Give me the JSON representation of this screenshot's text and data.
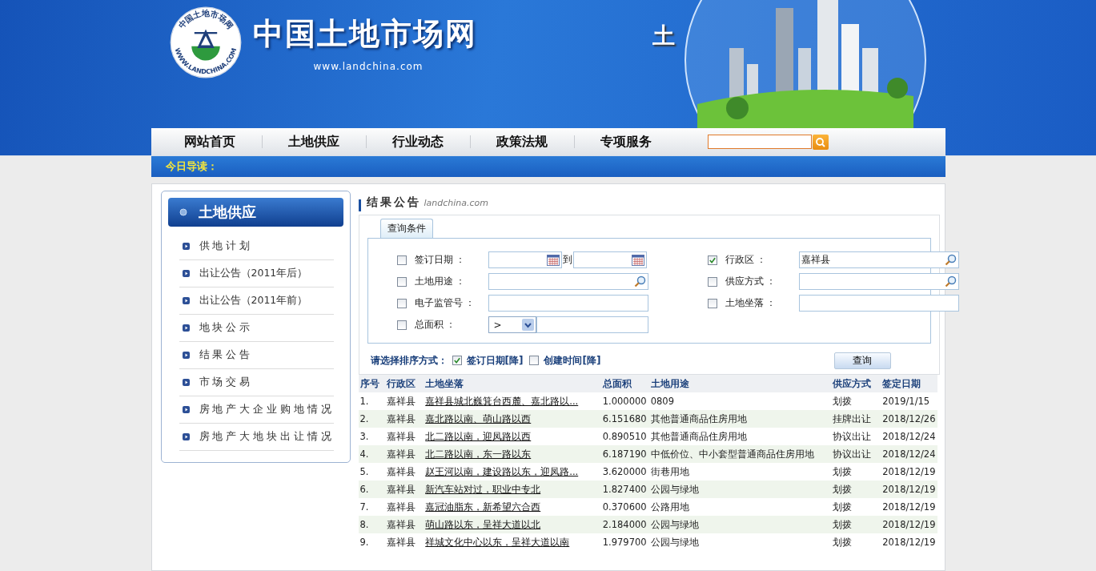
{
  "site": {
    "title": "中国土地市场网",
    "url": "www.landchina.com",
    "logo_ring_top": "中国土地市场网",
    "logo_ring_bottom": "WWW.LANDCHINA.COM",
    "banner_glyph": "土"
  },
  "nav": [
    {
      "label": "网站首页",
      "selected": false
    },
    {
      "label": "土地供应",
      "selected": false
    },
    {
      "label": "行业动态",
      "selected": false
    },
    {
      "label": "政策法规",
      "selected": false
    },
    {
      "label": "专项服务",
      "selected": false
    }
  ],
  "ticker": {
    "label": "今日导读："
  },
  "sidebar": {
    "title": "土地供应",
    "items": [
      {
        "label": "供 地 计 划",
        "selected": false
      },
      {
        "label": "出让公告（2011年后）",
        "selected": false
      },
      {
        "label": "出让公告（2011年前）",
        "selected": false
      },
      {
        "label": "地 块 公 示",
        "selected": false
      },
      {
        "label": "结 果 公 告",
        "selected": false
      },
      {
        "label": "市 场 交 易",
        "selected": false
      },
      {
        "label": "房 地 产 大 企 业 购 地 情 况",
        "selected": false
      },
      {
        "label": "房 地 产 大 地 块 出 让 情 况",
        "selected": false
      }
    ]
  },
  "section": {
    "title": "结果公告",
    "subtitle": "landchina.com"
  },
  "query": {
    "tab": "查询条件",
    "filters": [
      {
        "kind": "date_range",
        "label": "签订日期 ：",
        "checked": false,
        "separator": "到"
      },
      {
        "kind": "lookup",
        "label": "行政区 ：",
        "checked": true,
        "value": "嘉祥县"
      },
      {
        "kind": "lookup",
        "label": "土地用途 ：",
        "checked": false
      },
      {
        "kind": "lookup",
        "label": "供应方式 ：",
        "checked": false
      },
      {
        "kind": "text",
        "label": "电子监管号 ：",
        "checked": false
      },
      {
        "kind": "text",
        "label": "土地坐落 ：",
        "checked": false
      },
      {
        "kind": "compare",
        "label": "总面积 ：",
        "checked": false,
        "operator": ">"
      }
    ],
    "sort_label": "请选择排序方式：",
    "sort_options": [
      {
        "label": "签订日期[降]",
        "checked": true
      },
      {
        "label": "创建时间[降]",
        "checked": false
      }
    ],
    "button": "查询"
  },
  "table": {
    "columns": [
      "序号",
      "行政区",
      "土地坐落",
      "总面积",
      "土地用途",
      "供应方式",
      "签定日期"
    ],
    "rows": [
      [
        "1.",
        "嘉祥县",
        "嘉祥县城北巍箕台西麓、嘉北路以...",
        "1.000000",
        "0809",
        "划拨",
        "2019/1/15"
      ],
      [
        "2.",
        "嘉祥县",
        "嘉北路以南、萌山路以西",
        "6.151680",
        "其他普通商品住房用地",
        "挂牌出让",
        "2018/12/26"
      ],
      [
        "3.",
        "嘉祥县",
        "北二路以南，迎凤路以西",
        "0.890510",
        "其他普通商品住房用地",
        "协议出让",
        "2018/12/24"
      ],
      [
        "4.",
        "嘉祥县",
        "北二路以南，东一路以东",
        "6.187190",
        "中低价位、中小套型普通商品住房用地",
        "协议出让",
        "2018/12/24"
      ],
      [
        "5.",
        "嘉祥县",
        "赵王河以南，建设路以东，迎凤路...",
        "3.620000",
        "街巷用地",
        "划拨",
        "2018/12/19"
      ],
      [
        "6.",
        "嘉祥县",
        "新汽车站对过，职业中专北",
        "1.827400",
        "公园与绿地",
        "划拨",
        "2018/12/19"
      ],
      [
        "7.",
        "嘉祥县",
        "嘉冠油脂东，新希望六合西",
        "0.370600",
        "公路用地",
        "划拨",
        "2018/12/19"
      ],
      [
        "8.",
        "嘉祥县",
        "萌山路以东，呈祥大道以北",
        "2.184000",
        "公园与绿地",
        "划拨",
        "2018/12/19"
      ],
      [
        "9.",
        "嘉祥县",
        "祥城文化中心以东，呈祥大道以南",
        "1.979700",
        "公园与绿地",
        "划拨",
        "2018/12/19"
      ]
    ]
  }
}
